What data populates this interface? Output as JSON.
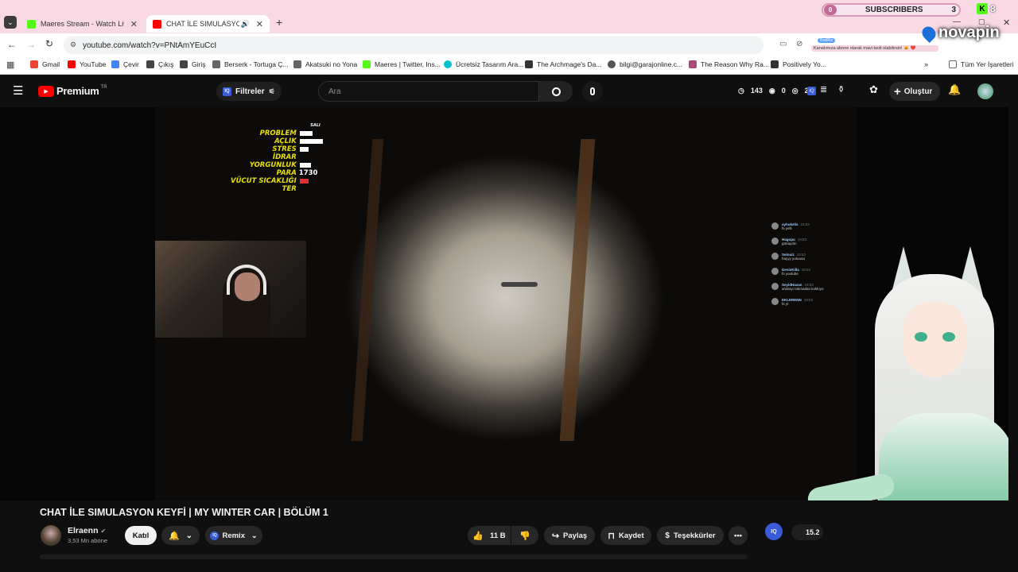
{
  "browser": {
    "tabs": [
      {
        "title": "Maeres Stream - Watch Live on",
        "favicon_color": "#53fc18"
      },
      {
        "title": "CHAT İLE SIMULASYON KEY",
        "favicon_color": "#ff0000"
      }
    ],
    "url": "youtube.com/watch?v=PNtAmYEuCcI",
    "bookmarks": [
      {
        "label": "Gmail",
        "color": "#ea4335"
      },
      {
        "label": "YouTube",
        "color": "#ff0000"
      },
      {
        "label": "Çevir",
        "color": "#4285f4"
      },
      {
        "label": "Çıkış",
        "color": "#444444"
      },
      {
        "label": "Giriş",
        "color": "#444444"
      },
      {
        "label": "Berserk - Tortuga Ç...",
        "color": "#666666"
      },
      {
        "label": "Akatsuki no Yona",
        "color": "#666666"
      },
      {
        "label": "Maeres | Twitter, Ins...",
        "color": "#53fc18"
      },
      {
        "label": "Ücretsiz Tasarım Ara...",
        "color": "#00c4cc"
      },
      {
        "label": "The Archmage's Da...",
        "color": "#333333"
      },
      {
        "label": "bilgi@garajonline.c...",
        "color": "#555555"
      },
      {
        "label": "The Reason Why Ra...",
        "color": "#a64d79"
      },
      {
        "label": "Positively Yo...",
        "color": "#333333"
      }
    ],
    "all_bookmarks": "Tüm Yer İşaretleri"
  },
  "overlay": {
    "sub_left": "0",
    "sub_label": "SUBSCRIBERS",
    "sub_right": "3",
    "kick_count": "8",
    "brand": "novapin",
    "notice_user": "BotRix",
    "notice_text": "Kanalımıza abone olarak mavi kedi olabilirsin! 🐱 ❤️"
  },
  "youtube": {
    "logo": "Premium",
    "logo_region": "TR",
    "filters": "Filtreler",
    "search_placeholder": "Ara",
    "stats": {
      "a": "143",
      "b": "0",
      "c": "2"
    },
    "create": "Oluştur"
  },
  "hud": {
    "day": "SALI",
    "rows": [
      {
        "label": "PROBLEM",
        "bar": 0.45
      },
      {
        "label": "AÇLIK",
        "bar": 0.8
      },
      {
        "label": "STRES",
        "bar": 0.3
      },
      {
        "label": "İDRAR",
        "bar": 0
      },
      {
        "label": "YORGUNLUK",
        "bar": 0.4
      },
      {
        "label": "PARA",
        "value": "1730"
      },
      {
        "label": "VÜCUT SICAKLIĞI",
        "bar": 0.3,
        "color": "#e03030"
      },
      {
        "label": "TER",
        "bar": 0
      }
    ]
  },
  "chat": [
    {
      "user": "ayhukelis",
      "time": "19:53",
      "msg": "hi yelli"
    },
    {
      "user": "Hagopu",
      "time": "19:53",
      "msg": "günaydın"
    },
    {
      "user": "Selouiz",
      "time": "19:53",
      "msg": "hayyy yutuuuu"
    },
    {
      "user": "DenisKilla",
      "time": "19:53",
      "msg": "hi youtube"
    },
    {
      "user": "SeyidHasan",
      "time": "19:53",
      "msg": "arabayı tokmadan kokkıyo"
    },
    {
      "user": "EKLERENN",
      "time": "19:53",
      "msg": "hi yt"
    }
  ],
  "video": {
    "title": "CHAT İLE SIMULASYON KEYFİ | MY WINTER CAR | BÖLÜM 1",
    "channel": "Elraenn",
    "subscribers": "3,53 Mn abone",
    "join": "Katıl",
    "remix": "Remix",
    "likes": "11 B",
    "share": "Paylaş",
    "save": "Kaydet",
    "thanks": "Teşekkürler",
    "partial_value": "15.2"
  }
}
